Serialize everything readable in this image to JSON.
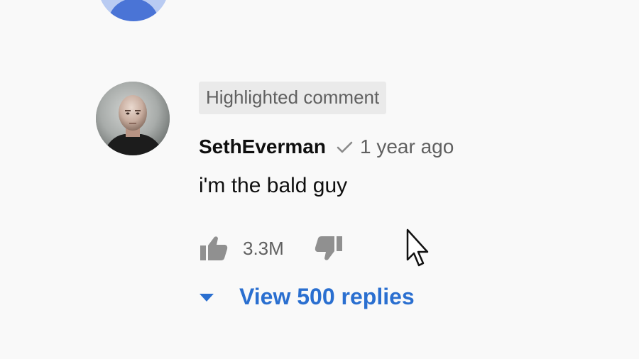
{
  "comment": {
    "badge": "Highlighted comment",
    "author": "SethEverman",
    "timestamp": "1 year ago",
    "text": "i'm the bald guy",
    "like_count": "3.3M",
    "view_replies_label": "View 500 replies"
  },
  "colors": {
    "background": "#f9f9f9",
    "badge_background": "#eaeaea",
    "secondary_text": "#606060",
    "link_blue": "#2a6fd0"
  },
  "icons": {
    "verified": "check-icon",
    "like": "thumbs-up-icon",
    "dislike": "thumbs-down-icon",
    "expand": "caret-down-icon",
    "pointer": "mouse-cursor-icon"
  }
}
